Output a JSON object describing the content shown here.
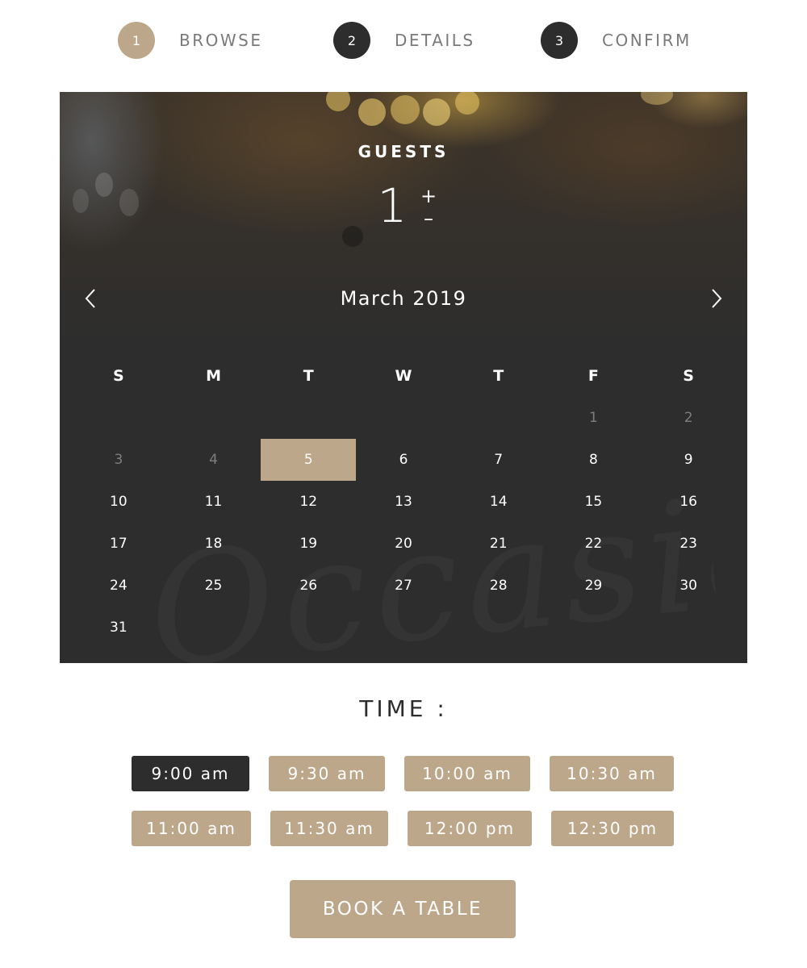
{
  "colors": {
    "accent": "#bda78b",
    "dark": "#2d2d2d",
    "step_inactive_label": "#7a7a7a",
    "muted_day": "#7e7e7e"
  },
  "steps": [
    {
      "number": "1",
      "label": "BROWSE",
      "state": "active"
    },
    {
      "number": "2",
      "label": "DETAILS",
      "state": "pending"
    },
    {
      "number": "3",
      "label": "CONFIRM",
      "state": "pending"
    }
  ],
  "guests": {
    "title": "GUESTS",
    "count": "1",
    "increment_icon": "plus-icon",
    "decrement_icon": "minus-icon",
    "increment_glyph": "+",
    "decrement_glyph": "–"
  },
  "calendar": {
    "month_label": "March 2019",
    "prev_icon": "chevron-left-icon",
    "next_icon": "chevron-right-icon",
    "weekdays": [
      "S",
      "M",
      "T",
      "W",
      "T",
      "F",
      "S"
    ],
    "days": [
      {
        "label": "",
        "state": "empty"
      },
      {
        "label": "",
        "state": "empty"
      },
      {
        "label": "",
        "state": "empty"
      },
      {
        "label": "",
        "state": "empty"
      },
      {
        "label": "",
        "state": "empty"
      },
      {
        "label": "1",
        "state": "muted"
      },
      {
        "label": "2",
        "state": "muted"
      },
      {
        "label": "3",
        "state": "muted"
      },
      {
        "label": "4",
        "state": "muted"
      },
      {
        "label": "5",
        "state": "selected"
      },
      {
        "label": "6",
        "state": "available"
      },
      {
        "label": "7",
        "state": "available"
      },
      {
        "label": "8",
        "state": "available"
      },
      {
        "label": "9",
        "state": "available"
      },
      {
        "label": "10",
        "state": "available"
      },
      {
        "label": "11",
        "state": "available"
      },
      {
        "label": "12",
        "state": "available"
      },
      {
        "label": "13",
        "state": "available"
      },
      {
        "label": "14",
        "state": "available"
      },
      {
        "label": "15",
        "state": "available"
      },
      {
        "label": "16",
        "state": "available"
      },
      {
        "label": "17",
        "state": "available"
      },
      {
        "label": "18",
        "state": "available"
      },
      {
        "label": "19",
        "state": "available"
      },
      {
        "label": "20",
        "state": "available"
      },
      {
        "label": "21",
        "state": "available"
      },
      {
        "label": "22",
        "state": "available"
      },
      {
        "label": "23",
        "state": "available"
      },
      {
        "label": "24",
        "state": "available"
      },
      {
        "label": "25",
        "state": "available"
      },
      {
        "label": "26",
        "state": "available"
      },
      {
        "label": "27",
        "state": "available"
      },
      {
        "label": "28",
        "state": "available"
      },
      {
        "label": "29",
        "state": "available"
      },
      {
        "label": "30",
        "state": "available"
      },
      {
        "label": "31",
        "state": "available"
      }
    ],
    "watermark": "Occasion"
  },
  "time": {
    "title": "TIME :",
    "slots": [
      {
        "label": "9:00 am",
        "selected": true
      },
      {
        "label": "9:30 am",
        "selected": false
      },
      {
        "label": "10:00 am",
        "selected": false
      },
      {
        "label": "10:30 am",
        "selected": false
      },
      {
        "label": "11:00 am",
        "selected": false
      },
      {
        "label": "11:30 am",
        "selected": false
      },
      {
        "label": "12:00 pm",
        "selected": false
      },
      {
        "label": "12:30 pm",
        "selected": false
      }
    ]
  },
  "book_button": {
    "label": "BOOK A TABLE"
  }
}
